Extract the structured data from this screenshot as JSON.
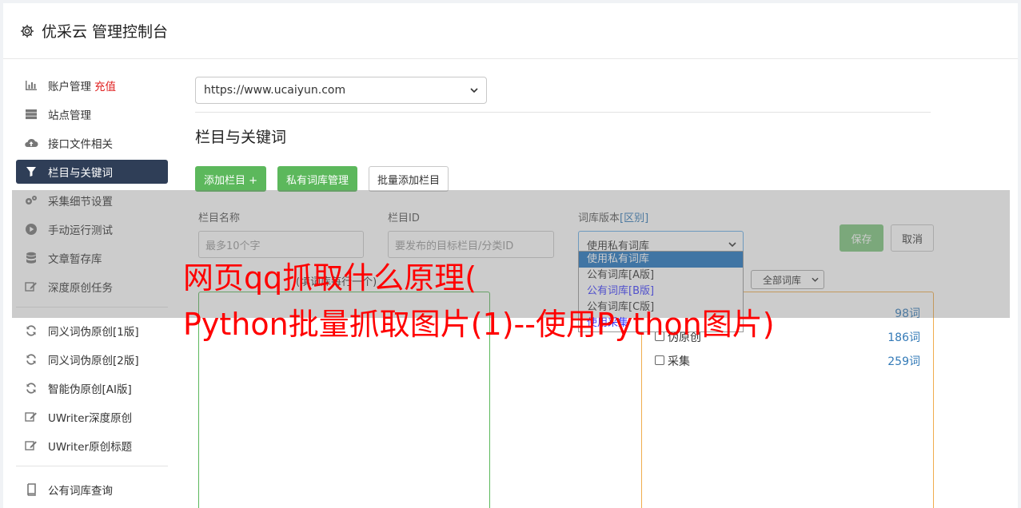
{
  "header": {
    "title": "优采云 管理控制台",
    "icon": "gear-icon"
  },
  "sidebar": {
    "items": [
      {
        "label": "账户管理",
        "extra": "充值",
        "icon": "bar-chart-icon",
        "active": false
      },
      {
        "label": "站点管理",
        "icon": "server-icon",
        "active": false
      },
      {
        "label": "接口文件相关",
        "icon": "cloud-upload-icon",
        "active": false
      },
      {
        "label": "栏目与关键词",
        "icon": "filter-icon",
        "active": true
      },
      {
        "label": "采集细节设置",
        "icon": "gears-icon",
        "active": false
      },
      {
        "label": "手动运行测试",
        "icon": "play-circle-icon",
        "active": false
      },
      {
        "label": "文章暂存库",
        "icon": "database-icon",
        "active": false
      },
      {
        "label": "深度原创任务",
        "icon": "edit-icon",
        "active": false
      }
    ],
    "items2": [
      {
        "label": "同义词伪原创[1版]",
        "icon": "refresh-icon"
      },
      {
        "label": "同义词伪原创[2版]",
        "icon": "refresh-icon"
      },
      {
        "label": "智能伪原创[AI版]",
        "icon": "refresh-icon"
      },
      {
        "label": "UWriter深度原创",
        "icon": "edit-icon"
      },
      {
        "label": "UWriter原创标题",
        "icon": "edit-icon"
      }
    ],
    "items3": [
      {
        "label": "公有词库查询",
        "icon": "book-icon"
      }
    ]
  },
  "main": {
    "site_select": "https://www.ucaiyun.com",
    "section_title": "栏目与关键词",
    "buttons": {
      "add_column": "添加栏目 +",
      "private_lib": "私有词库管理",
      "batch_add": "批量添加栏目"
    },
    "form": {
      "name_label": "栏目名称",
      "name_placeholder": "最多10个字",
      "id_label": "栏目ID",
      "id_placeholder": "要发布的目标栏目/分类ID",
      "version_label": "词库版本",
      "version_link": "[区别]",
      "version_value": "使用私有词库",
      "save": "保存",
      "cancel": "取消"
    },
    "dropdown_options": [
      "使用私有词库",
      "公有词库[A版]",
      "公有词库[B版]",
      "公有词库[C版]",
      "使用采集"
    ],
    "left_box_label": "(填词库每行一个)",
    "lib_filter": "全部词库",
    "libraries": [
      {
        "name": "",
        "count": "98词"
      },
      {
        "name": "伪原创",
        "count": "186词"
      },
      {
        "name": "采集",
        "count": "259词"
      }
    ]
  },
  "overlay": {
    "line1": "网页qq抓取什么原理(",
    "line2": "Python批量抓取图片(1)--使用Python图片)"
  },
  "colors": {
    "accent": "#2f3e57",
    "green": "#5cb85c",
    "orange": "#f0ad4e",
    "headline": "#ff0000"
  }
}
